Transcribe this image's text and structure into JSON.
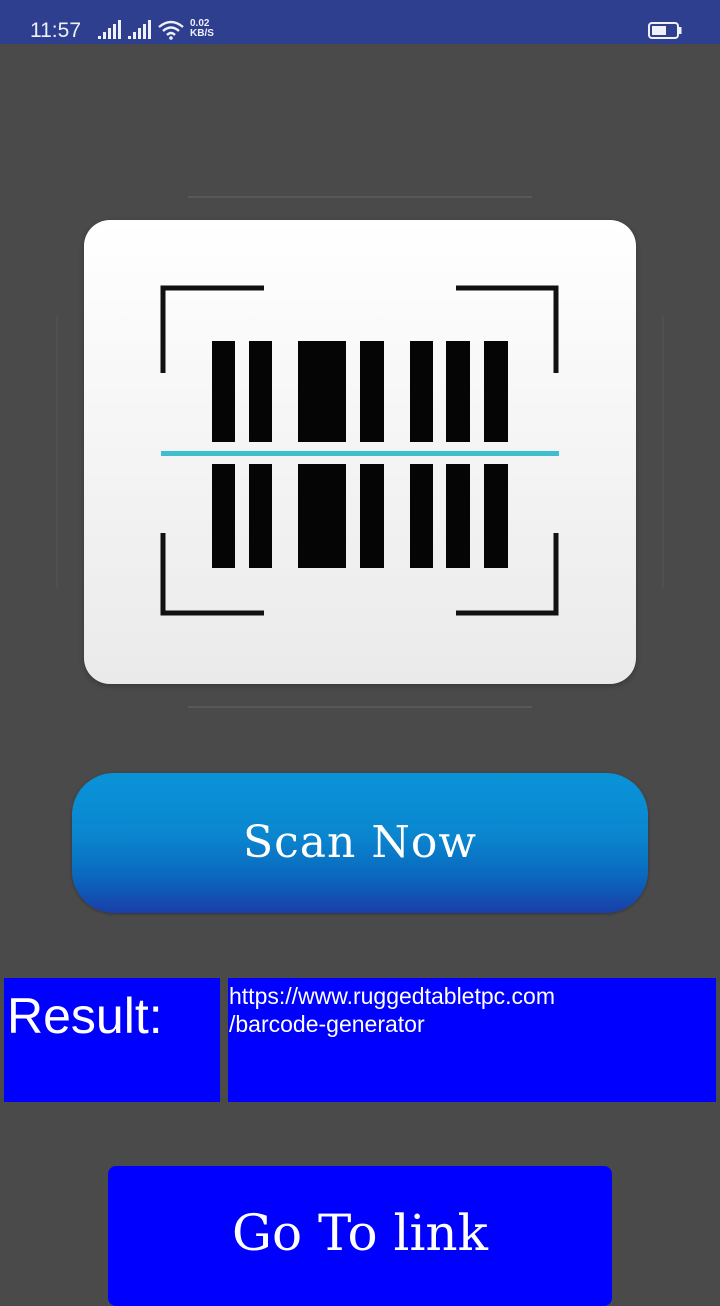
{
  "status_bar": {
    "time": "11:57",
    "network_speed_value": "0.02",
    "network_speed_unit": "KB/S",
    "icons": [
      "signal-icon",
      "signal-icon",
      "wifi-icon",
      "battery-icon"
    ]
  },
  "scanner": {
    "icon": "barcode-scanner-icon",
    "scan_line_color": "#3dbfd0"
  },
  "scan_button": {
    "label": "Scan Now"
  },
  "result": {
    "label": "Result:",
    "value": "https://www.ruggedtabletpc.com\n/barcode-generator"
  },
  "link_button": {
    "label": "Go To link"
  },
  "colors": {
    "background": "#4a4a4a",
    "status_bar": "#2f3f8f",
    "accent_blue": "#0000fe",
    "scan_button_top": "#0a93d8",
    "scan_button_bottom": "#1a3ea8"
  }
}
